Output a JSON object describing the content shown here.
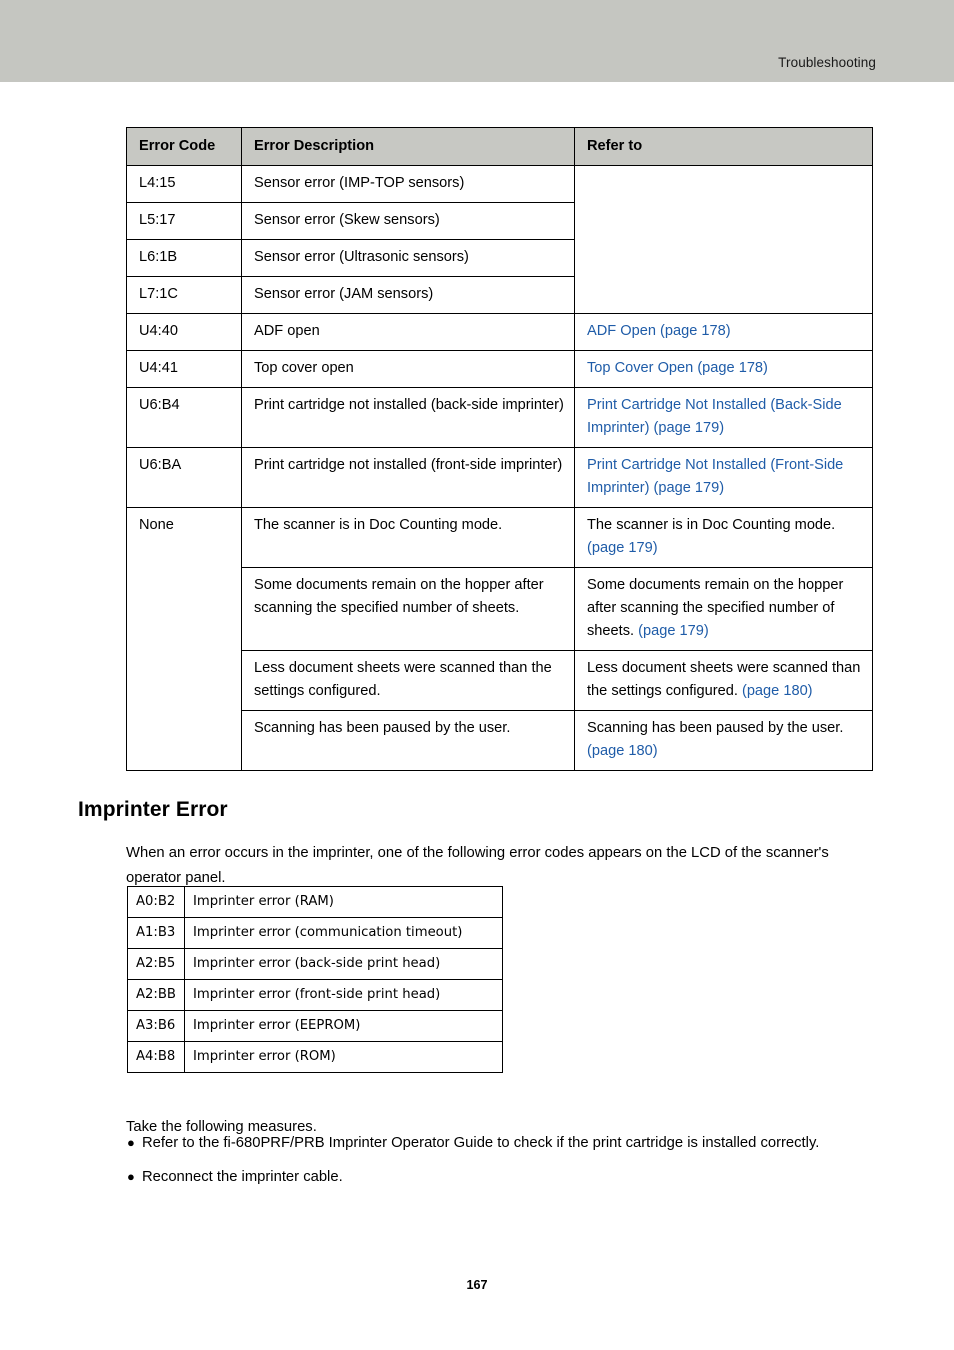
{
  "header": {
    "title": "Troubleshooting"
  },
  "error_table": {
    "columns": [
      "Error Code",
      "Error Description",
      "Refer to"
    ],
    "rows": [
      {
        "code": "L4:15",
        "description": "Sensor error (IMP-TOP sensors)",
        "refer_plain": "",
        "refer_link": ""
      },
      {
        "code": "L5:17",
        "description": "Sensor error (Skew sensors)",
        "refer_plain": "",
        "refer_link": ""
      },
      {
        "code": "L6:1B",
        "description": "Sensor error (Ultrasonic sensors)",
        "refer_plain": "",
        "refer_link": ""
      },
      {
        "code": "L7:1C",
        "description": "Sensor error (JAM sensors)",
        "refer_plain": "",
        "refer_link": ""
      },
      {
        "code": "U4:40",
        "description": "ADF open",
        "refer_plain": "",
        "refer_link": "ADF Open (page 178)"
      },
      {
        "code": "U4:41",
        "description": "Top cover open",
        "refer_plain": "",
        "refer_link": "Top Cover Open (page 178)"
      },
      {
        "code": "U6:B4",
        "description": "Print cartridge not installed (back-side imprinter)",
        "refer_plain": "",
        "refer_link": "Print Cartridge Not Installed (Back-Side Imprinter) (page 179)"
      },
      {
        "code": "U6:BA",
        "description": "Print cartridge not installed (front-side imprinter)",
        "refer_plain": "",
        "refer_link": "Print Cartridge Not Installed (Front-Side Imprinter) (page 179)"
      },
      {
        "code": "None",
        "description": "The scanner is in Doc Counting mode.",
        "refer_plain": "The scanner is in Doc Counting mode. ",
        "refer_link": "(page 179)"
      },
      {
        "code": "",
        "description": "Some documents remain on the hopper after scanning the specified number of sheets.",
        "refer_plain": "Some documents remain on the hopper after scanning the specified number of sheets. ",
        "refer_link": "(page 179)"
      },
      {
        "code": "",
        "description": "Less document sheets were scanned than the settings configured.",
        "refer_plain": "Less document sheets were scanned than the settings configured. ",
        "refer_link": "(page 180)"
      },
      {
        "code": "",
        "description": "Scanning has been paused by the user.",
        "refer_plain": "Scanning has been paused by the user. ",
        "refer_link": "(page 180)"
      }
    ]
  },
  "imprinter_section": {
    "heading": "Imprinter Error",
    "intro": "When an error occurs in the imprinter, one of the following error codes appears on the LCD of the scanner's operator panel.",
    "codes": [
      {
        "code": "A0:B2",
        "description": "Imprinter error (RAM)"
      },
      {
        "code": "A1:B3",
        "description": "Imprinter error (communication timeout)"
      },
      {
        "code": "A2:B5",
        "description": "Imprinter error (back-side print head)"
      },
      {
        "code": "A2:BB",
        "description": "Imprinter error (front-side print head)"
      },
      {
        "code": "A3:B6",
        "description": "Imprinter error (EEPROM)"
      },
      {
        "code": "A4:B8",
        "description": "Imprinter error (ROM)"
      }
    ],
    "measures_lead": "Take the following measures.",
    "measures": [
      "Refer to the fi-680PRF/PRB Imprinter Operator Guide to check if the print cartridge is installed correctly.",
      "Reconnect the imprinter cable."
    ],
    "bullet_glyph": "●"
  },
  "footer": {
    "page_number": "167"
  },
  "colors": {
    "header_band": "#c5c6c1",
    "table_header": "#c7c8c3",
    "link": "#1f5ca8",
    "text": "#000000"
  }
}
